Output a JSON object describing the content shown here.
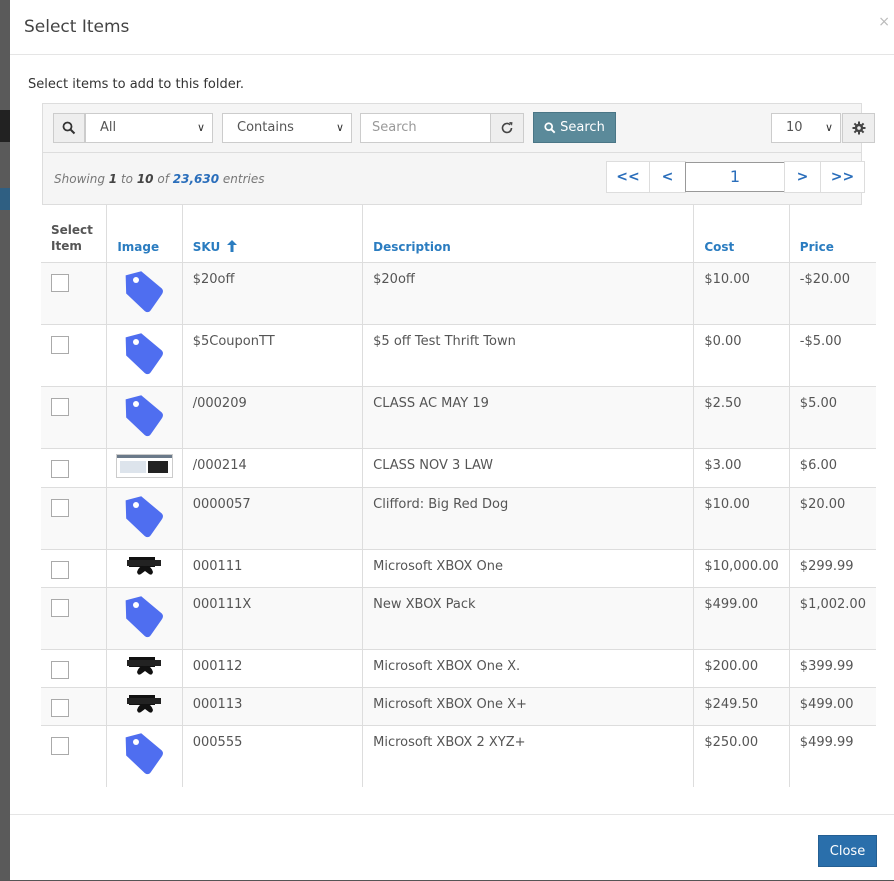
{
  "modal": {
    "title": "Select Items",
    "close_symbol": "×",
    "intro": "Select items to add to this folder."
  },
  "toolbar": {
    "field_select": "All",
    "match_select": "Contains",
    "search_placeholder": "Search",
    "search_button": "Search",
    "page_size": "10"
  },
  "info": {
    "showing": "Showing",
    "from": "1",
    "to_word": "to",
    "to": "10",
    "of_word": "of",
    "total": "23,630",
    "entries": "entries"
  },
  "pager": {
    "first": "<<",
    "prev": "<",
    "page": "1",
    "next": ">",
    "last": ">>"
  },
  "table": {
    "headers": {
      "select_line1": "Select",
      "select_line2": "Item",
      "image": "Image",
      "sku": "SKU",
      "description": "Description",
      "cost": "Cost",
      "price": "Price"
    },
    "rows": [
      {
        "image": "tag-icon",
        "sku": "$20off",
        "description": "$20off",
        "cost": "$10.00",
        "price": "-$20.00"
      },
      {
        "image": "tag-icon",
        "sku": "$5CouponTT",
        "description": "$5 off Test Thrift Town",
        "cost": "$0.00",
        "price": "-$5.00"
      },
      {
        "image": "tag-icon",
        "sku": "/000209",
        "description": "CLASS AC MAY 19",
        "cost": "$2.50",
        "price": "$5.00"
      },
      {
        "image": "screenshot-thumbnail",
        "sku": "/000214",
        "description": "CLASS NOV 3 LAW",
        "cost": "$3.00",
        "price": "$6.00"
      },
      {
        "image": "tag-icon",
        "sku": "0000057",
        "description": "Clifford: Big Red Dog",
        "cost": "$10.00",
        "price": "$20.00"
      },
      {
        "image": "xbox-console-icon",
        "sku": "000111",
        "description": "Microsoft XBOX One",
        "cost": "$10,000.00",
        "price": "$299.99"
      },
      {
        "image": "tag-icon",
        "sku": "000111X",
        "description": "New XBOX Pack",
        "cost": "$499.00",
        "price": "$1,002.00"
      },
      {
        "image": "xbox-console-icon",
        "sku": "000112",
        "description": "Microsoft XBOX One X.",
        "cost": "$200.00",
        "price": "$399.99"
      },
      {
        "image": "xbox-console-icon",
        "sku": "000113",
        "description": "Microsoft XBOX One X+",
        "cost": "$249.50",
        "price": "$499.00"
      },
      {
        "image": "tag-icon",
        "sku": "000555",
        "description": "Microsoft XBOX 2 XYZ+",
        "cost": "$250.00",
        "price": "$499.99"
      }
    ]
  },
  "footer": {
    "close_button": "Close"
  },
  "colors": {
    "search_button": "#5b8a9a",
    "close_button": "#2a6fab",
    "link_blue": "#2a7cc0",
    "tag_icon": "#4f6ef0"
  }
}
